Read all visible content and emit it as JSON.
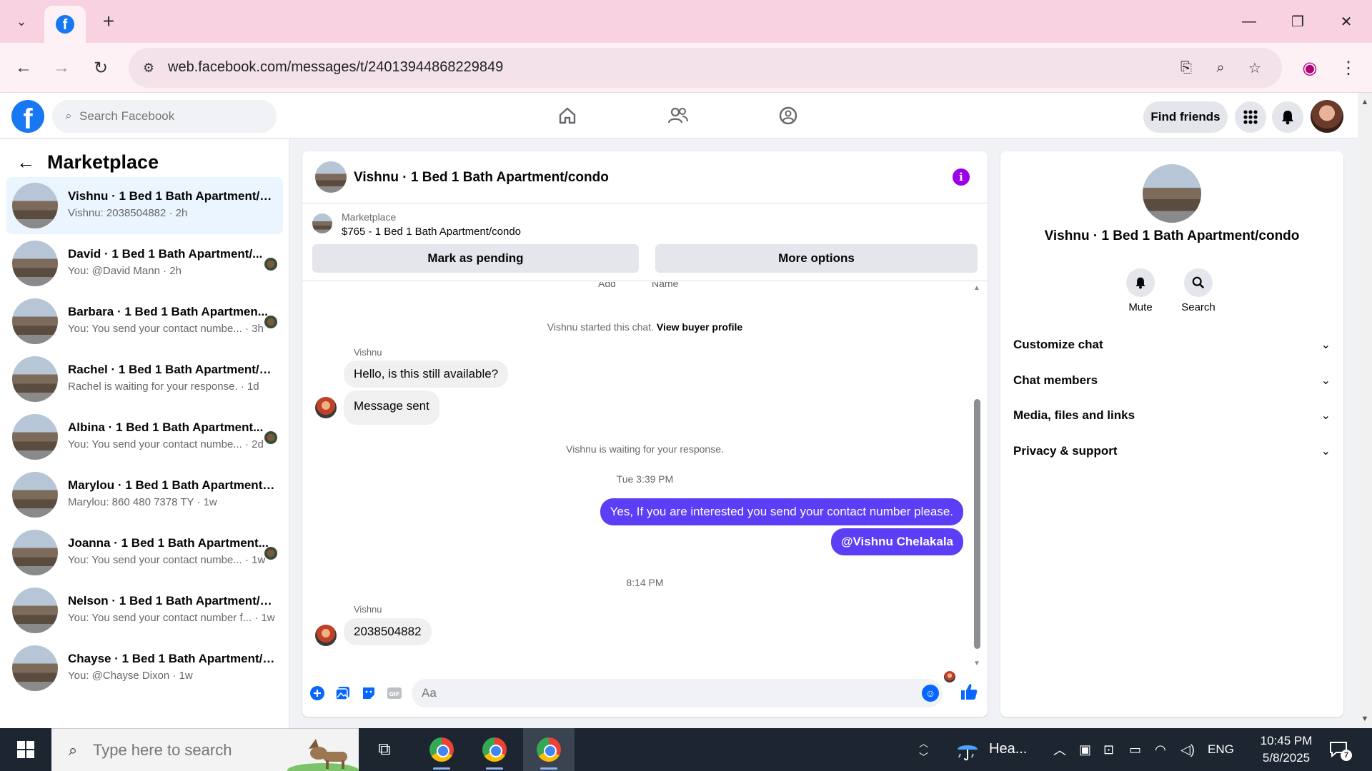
{
  "browser": {
    "url": "web.facebook.com/messages/t/24013944868229849"
  },
  "fb_header": {
    "search_placeholder": "Search Facebook",
    "find_friends": "Find friends"
  },
  "sidebar": {
    "title": "Marketplace",
    "conversations": [
      {
        "name": "Vishnu · 1 Bed 1 Bath Apartment/c...",
        "subtitle": "Vishnu: 2038504882 · 2h",
        "active": true
      },
      {
        "name": "David · 1 Bed 1 Bath Apartment/...",
        "subtitle": "You: @David Mann · 2h"
      },
      {
        "name": "Barbara · 1 Bed 1 Bath Apartmen...",
        "subtitle": "You: You send your contact numbe... · 3h"
      },
      {
        "name": "Rachel · 1 Bed 1 Bath Apartment/c...",
        "subtitle": "Rachel is waiting for your response. · 1d"
      },
      {
        "name": "Albina · 1 Bed 1 Bath Apartment...",
        "subtitle": "You: You send your contact numbe... · 2d"
      },
      {
        "name": "Marylou · 1 Bed 1 Bath Apartment/...",
        "subtitle": "Marylou: 860 480 7378 TY · 1w"
      },
      {
        "name": "Joanna · 1 Bed 1 Bath Apartment...",
        "subtitle": "You: You send your contact numbe... · 1w"
      },
      {
        "name": "Nelson · 1 Bed 1 Bath Apartment/c...",
        "subtitle": "You: You send your contact number f... · 1w"
      },
      {
        "name": "Chayse · 1 Bed 1 Bath Apartment/c...",
        "subtitle": "You: @Chayse Dixon · 1w"
      }
    ]
  },
  "chat": {
    "title": "Vishnu · 1 Bed 1 Bath Apartment/condo",
    "listing_label": "Marketplace",
    "listing_price": "$765 - 1 Bed 1 Bath Apartment/condo",
    "mark_pending": "Mark as pending",
    "more_options": "More options",
    "cut_add": "Add",
    "cut_name": "Name",
    "started_text": "Vishnu started this chat.",
    "view_buyer": "View buyer profile",
    "sender_name": "Vishnu",
    "msg1": "Hello, is this still available?",
    "msg2": "Message sent",
    "waiting": "Vishnu is waiting for your response.",
    "time1": "Tue 3:39 PM",
    "out1": "Yes, If you are  interested you send your contact number please.",
    "out2": "@Vishnu Chelakala",
    "time2": "8:14 PM",
    "sender_name2": "Vishnu",
    "msg3": "2038504882",
    "composer_placeholder": "Aa"
  },
  "info_panel": {
    "name": "Vishnu · 1 Bed 1 Bath Apartment/condo",
    "mute": "Mute",
    "search": "Search",
    "sections": [
      "Customize chat",
      "Chat members",
      "Media, files and links",
      "Privacy & support"
    ]
  },
  "taskbar": {
    "search_placeholder": "Type here to search",
    "weather": "Hea...",
    "language": "ENG",
    "time": "10:45 PM",
    "date": "5/8/2025",
    "notifications": "7"
  },
  "colors": {
    "fb_blue": "#1877f2",
    "outgoing_bubble": "#5b3ef5",
    "info_icon": "#9b00e8",
    "tabbar": "#f8d2e0"
  }
}
